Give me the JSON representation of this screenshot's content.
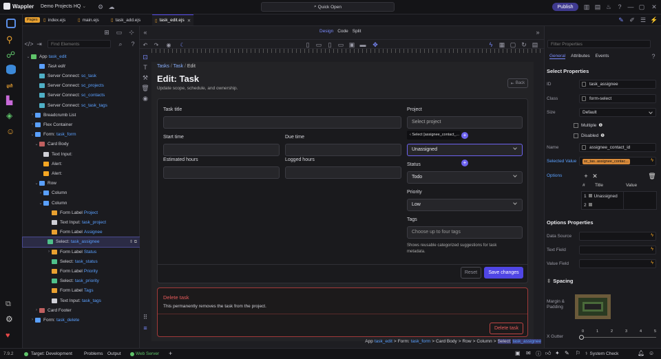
{
  "app": {
    "logo": "Wappler",
    "project": "Demo Projects HQ",
    "quick_open": "Quick Open",
    "publish": "Publish",
    "version": "7.9.2"
  },
  "tabs": {
    "pages_badge": "Pages",
    "items": [
      "index.ejs",
      "main.ejs",
      "task_add.ejs",
      "task_edit.ejs"
    ]
  },
  "tree": {
    "search_placeholder": "Find Elements",
    "rows": [
      {
        "label": "App",
        "name": "task_edit"
      },
      {
        "label": "Task edit",
        "name": ""
      },
      {
        "label": "Server Connect:",
        "name": "sc_task"
      },
      {
        "label": "Server Connect:",
        "name": "sc_projects"
      },
      {
        "label": "Server Connect:",
        "name": "sc_contacts"
      },
      {
        "label": "Server Connect:",
        "name": "sc_task_tags"
      },
      {
        "label": "Breadcrumb List",
        "name": ""
      },
      {
        "label": "Flex Container",
        "name": ""
      },
      {
        "label": "Form:",
        "name": "task_form"
      },
      {
        "label": "Card Body",
        "name": ""
      },
      {
        "label": "Text Input:",
        "name": ""
      },
      {
        "label": "Alert:",
        "name": ""
      },
      {
        "label": "Alert:",
        "name": ""
      },
      {
        "label": "Row",
        "name": ""
      },
      {
        "label": "Column",
        "name": ""
      },
      {
        "label": "Column",
        "name": ""
      },
      {
        "label": "Form Label",
        "name": "Project"
      },
      {
        "label": "Text Input:",
        "name": "task_project"
      },
      {
        "label": "Form Label",
        "name": "Assignee"
      },
      {
        "label": "Select:",
        "name": "task_assignee"
      },
      {
        "label": "Form Label",
        "name": "Status"
      },
      {
        "label": "Select:",
        "name": "task_status"
      },
      {
        "label": "Form Label",
        "name": "Priority"
      },
      {
        "label": "Select:",
        "name": "task_priority"
      },
      {
        "label": "Form Label",
        "name": "Tags"
      },
      {
        "label": "Text Input:",
        "name": "task_tags"
      },
      {
        "label": "Card Footer",
        "name": ""
      },
      {
        "label": "Form:",
        "name": "task_delete"
      }
    ]
  },
  "toolbar": {
    "design": "Design",
    "code": "Code",
    "split": "Split"
  },
  "page": {
    "crumb1": "Tasks",
    "crumb2": "Task",
    "crumb3": "Edit",
    "title": "Edit: Task",
    "subtitle": "Update scope, schedule, and ownership.",
    "back": "Back",
    "task_title": "Task title",
    "start_time": "Start time",
    "due_time": "Due time",
    "estimated_hours": "Estimated hours",
    "logged_hours": "Logged hours",
    "project": "Project",
    "project_placeholder": "Select project",
    "assignee_tooltip": "Select [assignee_contact_...",
    "assignee_value": "Unassigned",
    "status": "Status",
    "status_value": "Todo",
    "priority": "Priority",
    "priority_value": "Low",
    "tags": "Tags",
    "tags_placeholder": "Choose up to four tags",
    "tags_help": "Shows reusable categorized suggestions for task metadata.",
    "reset": "Reset",
    "save": "Save changes",
    "delete_title": "Delete task",
    "delete_text": "This permanently removes the task from the project.",
    "delete_button": "Delete task"
  },
  "breadcrumb_path": [
    "App",
    "task_edit",
    ">",
    "Form:",
    "task_form",
    ">",
    "Card Body",
    ">",
    "Row",
    ">",
    "Column",
    ">",
    "Select:",
    "task_assignee"
  ],
  "props": {
    "filter_placeholder": "Filter Properties",
    "tabs": [
      "General",
      "Attributes",
      "Events"
    ],
    "select_props": "Select Properties",
    "id_label": "ID",
    "id_value": "task_assignee",
    "class_label": "Class",
    "class_value": "form-select",
    "size_label": "Size",
    "size_value": "Default",
    "multiple": "Multiple",
    "disabled": "Disabled",
    "name_label": "Name",
    "name_value": "assignee_contact_id",
    "selected_label": "Selected Value",
    "selected_value": "sc_tas..assignee_contac...",
    "options_label": "Options",
    "options_headers": [
      "#",
      "Title",
      "Value"
    ],
    "options_rows": [
      {
        "n": "1",
        "title": "Unassigned"
      },
      {
        "n": "2",
        "title": ""
      }
    ],
    "options_props": "Options Properties",
    "data_source": "Data Source",
    "text_field": "Text Field",
    "value_field": "Value Field",
    "spacing": "Spacing",
    "margin_padding": "Margin & Padding",
    "x_gutter": "X Gutter",
    "gutter_ticks": [
      "0",
      "1",
      "2",
      "3",
      "4",
      "5"
    ]
  },
  "status": {
    "target": "Target: Development",
    "problems": "Problems",
    "output": "Output",
    "web_server": "Web Server",
    "system_check": "System Check"
  },
  "colors": {
    "accent": "#5046e5",
    "link": "#5aa0ff",
    "danger": "#e04848",
    "warning": "#f5a623"
  }
}
